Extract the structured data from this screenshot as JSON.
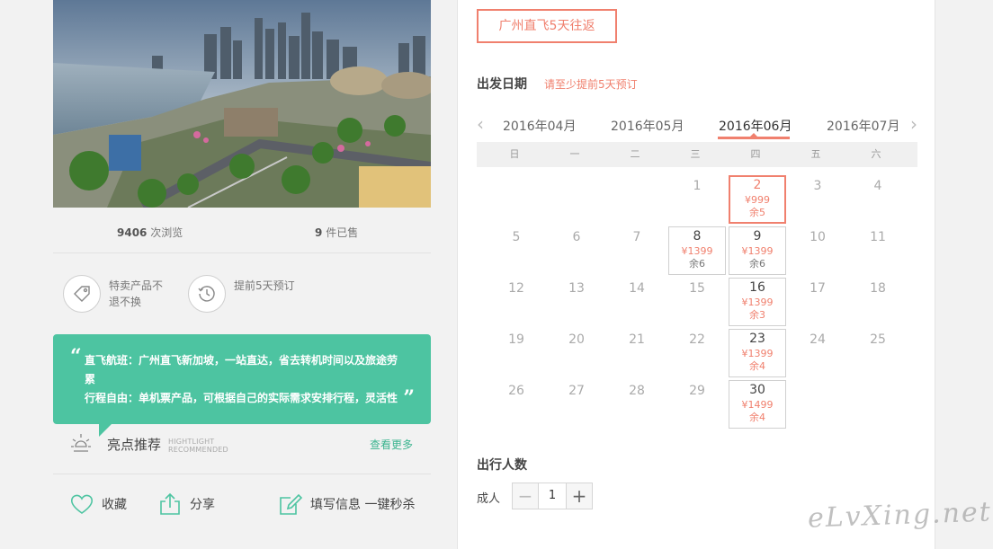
{
  "product": {
    "views_count": "9406",
    "views_suffix": "次浏览",
    "sold_count": "9",
    "sold_suffix": "件已售"
  },
  "features": [
    {
      "icon": "tag-icon",
      "text": "特卖产品不退不换"
    },
    {
      "icon": "clock-icon",
      "text": "提前5天预订"
    }
  ],
  "highlights_quote": {
    "open_mark": "“",
    "close_mark": "”",
    "lines": [
      "直飞航班：广州直飞新加坡，一站直达，省去转机时间以及旅途劳累",
      "行程自由：单机票产品，可根据自己的实际需求安排行程，灵活性"
    ]
  },
  "highlight": {
    "title": "亮点推荐",
    "en_line1": "HIGHTLIGHT",
    "en_line2": "RECOMMENDED",
    "more": "查看更多"
  },
  "actions": {
    "favorite": "收藏",
    "share": "分享",
    "fill_info": "填写信息 一键秒杀"
  },
  "booking": {
    "route_tab": "广州直飞5天往返",
    "departure_title": "出发日期",
    "departure_note": "请至少提前5天预订",
    "months": [
      "2016年04月",
      "2016年05月",
      "2016年06月",
      "2016年07月"
    ],
    "active_month_index": 2,
    "weekdays": [
      "日",
      "一",
      "二",
      "三",
      "四",
      "五",
      "六"
    ],
    "days": [
      {
        "day": "1",
        "col": 3,
        "row": 0
      },
      {
        "day": "2",
        "col": 4,
        "row": 0,
        "price": "¥999",
        "remain": "余5",
        "selected": true
      },
      {
        "day": "3",
        "col": 5,
        "row": 0
      },
      {
        "day": "4",
        "col": 6,
        "row": 0
      },
      {
        "day": "5",
        "col": 0,
        "row": 1
      },
      {
        "day": "6",
        "col": 1,
        "row": 1
      },
      {
        "day": "7",
        "col": 2,
        "row": 1
      },
      {
        "day": "8",
        "col": 3,
        "row": 1,
        "price": "¥1399",
        "remain": "余6"
      },
      {
        "day": "9",
        "col": 4,
        "row": 1,
        "price": "¥1399",
        "remain": "余6"
      },
      {
        "day": "10",
        "col": 5,
        "row": 1
      },
      {
        "day": "11",
        "col": 6,
        "row": 1
      },
      {
        "day": "12",
        "col": 0,
        "row": 2
      },
      {
        "day": "13",
        "col": 1,
        "row": 2
      },
      {
        "day": "14",
        "col": 2,
        "row": 2
      },
      {
        "day": "15",
        "col": 3,
        "row": 2
      },
      {
        "day": "16",
        "col": 4,
        "row": 2,
        "price": "¥1399",
        "remain": "余3",
        "red_remain": true
      },
      {
        "day": "17",
        "col": 5,
        "row": 2
      },
      {
        "day": "18",
        "col": 6,
        "row": 2
      },
      {
        "day": "19",
        "col": 0,
        "row": 3
      },
      {
        "day": "20",
        "col": 1,
        "row": 3
      },
      {
        "day": "21",
        "col": 2,
        "row": 3
      },
      {
        "day": "22",
        "col": 3,
        "row": 3
      },
      {
        "day": "23",
        "col": 4,
        "row": 3,
        "price": "¥1399",
        "remain": "余4",
        "red_remain": true
      },
      {
        "day": "24",
        "col": 5,
        "row": 3
      },
      {
        "day": "25",
        "col": 6,
        "row": 3
      },
      {
        "day": "26",
        "col": 0,
        "row": 4
      },
      {
        "day": "27",
        "col": 1,
        "row": 4
      },
      {
        "day": "28",
        "col": 2,
        "row": 4
      },
      {
        "day": "29",
        "col": 3,
        "row": 4
      },
      {
        "day": "30",
        "col": 4,
        "row": 4,
        "price": "¥1499",
        "remain": "余4",
        "red_remain": true
      }
    ],
    "travelers_title": "出行人数",
    "adult_label": "成人",
    "adult_count": "1",
    "minus": "−",
    "plus": "+"
  },
  "watermark": "eLvXing.net",
  "colors": {
    "accent": "#f0806e",
    "green": "#4dc4a1"
  }
}
